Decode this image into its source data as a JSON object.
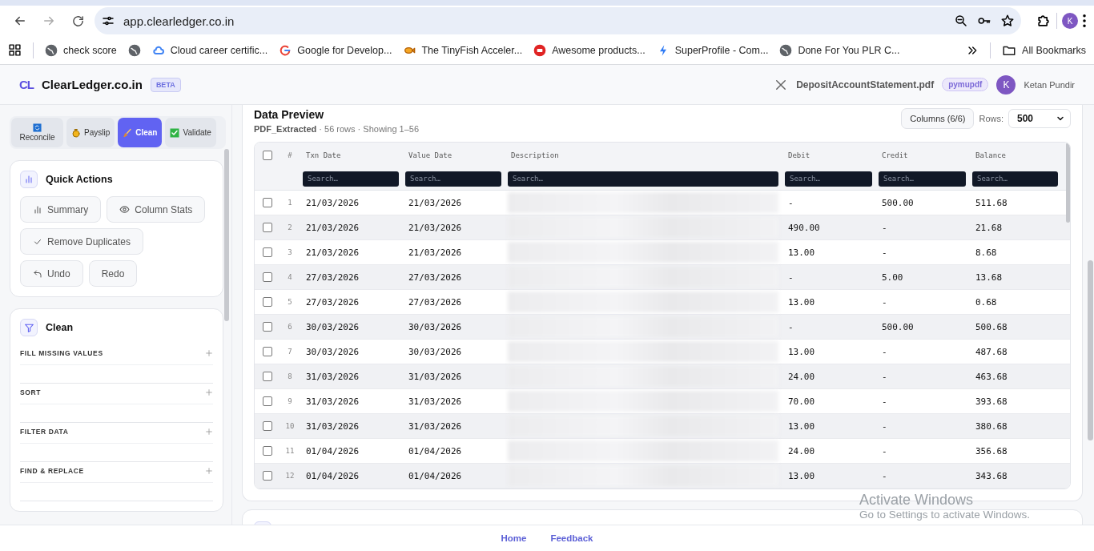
{
  "browser": {
    "url": "app.clearledger.co.in",
    "profile_initial": "K",
    "bookmarks": [
      {
        "label": "check score"
      },
      {
        "label": "Cloud career certific..."
      },
      {
        "label": "Google for Develop..."
      },
      {
        "label": "The TinyFish Acceler..."
      },
      {
        "label": "Awesome products..."
      },
      {
        "label": "SuperProfile - Com..."
      },
      {
        "label": "Done For You PLR C..."
      }
    ],
    "all_bookmarks": "All Bookmarks"
  },
  "app": {
    "logo_mark": "CL",
    "name": "ClearLedger.co.in",
    "badge": "BETA",
    "file_name": "DepositAccountStatement.pdf",
    "engine": "pymupdf",
    "user_initial": "K",
    "user_name": "Ketan Pundir"
  },
  "sidebar": {
    "tabs": [
      {
        "label": "Reconcile",
        "selected": false
      },
      {
        "label": "Payslip",
        "selected": false
      },
      {
        "label": "Clean",
        "selected": true
      },
      {
        "label": "Validate",
        "selected": false
      }
    ],
    "quick_actions": {
      "title": "Quick Actions",
      "buttons": [
        {
          "label": "Summary"
        },
        {
          "label": "Column Stats"
        },
        {
          "label": "Remove Duplicates"
        },
        {
          "label": "Undo"
        },
        {
          "label": "Redo"
        }
      ]
    },
    "clean": {
      "title": "Clean",
      "sections": [
        {
          "label": "FILL MISSING VALUES",
          "expanded": false
        },
        {
          "label": "SORT",
          "expanded": false
        },
        {
          "label": "FILTER DATA",
          "expanded": false
        },
        {
          "label": "FIND & REPLACE",
          "expanded": false
        }
      ]
    }
  },
  "preview": {
    "title": "Data Preview",
    "source": "PDF_Extracted",
    "meta": " · 56 rows · Showing 1–56",
    "columns_button": "Columns (6/6)",
    "rows_label": "Rows:",
    "rows_value": "500",
    "table": {
      "all_checked": false,
      "number_header": "#",
      "columns": [
        {
          "name": "Txn Date",
          "placeholder": "Search…"
        },
        {
          "name": "Value Date",
          "placeholder": "Search…"
        },
        {
          "name": "Description",
          "placeholder": "Search…"
        },
        {
          "name": "Debit",
          "placeholder": "Search…"
        },
        {
          "name": "Credit",
          "placeholder": "Search…"
        },
        {
          "name": "Balance",
          "placeholder": "Search…"
        }
      ],
      "rows": [
        {
          "n": "1",
          "checked": false,
          "cells": [
            "21/03/2026",
            "21/03/2026",
            "",
            "-",
            "500.00",
            "511.68"
          ]
        },
        {
          "n": "2",
          "checked": false,
          "cells": [
            "21/03/2026",
            "21/03/2026",
            "",
            "490.00",
            "-",
            "21.68"
          ]
        },
        {
          "n": "3",
          "checked": false,
          "cells": [
            "21/03/2026",
            "21/03/2026",
            "",
            "13.00",
            "-",
            "8.68"
          ]
        },
        {
          "n": "4",
          "checked": false,
          "cells": [
            "27/03/2026",
            "27/03/2026",
            "",
            "-",
            "5.00",
            "13.68"
          ]
        },
        {
          "n": "5",
          "checked": false,
          "cells": [
            "27/03/2026",
            "27/03/2026",
            "",
            "13.00",
            "-",
            "0.68"
          ]
        },
        {
          "n": "6",
          "checked": false,
          "cells": [
            "30/03/2026",
            "30/03/2026",
            "",
            "-",
            "500.00",
            "500.68"
          ]
        },
        {
          "n": "7",
          "checked": false,
          "cells": [
            "30/03/2026",
            "30/03/2026",
            "",
            "13.00",
            "-",
            "487.68"
          ]
        },
        {
          "n": "8",
          "checked": false,
          "cells": [
            "31/03/2026",
            "31/03/2026",
            "",
            "24.00",
            "-",
            "463.68"
          ]
        },
        {
          "n": "9",
          "checked": false,
          "cells": [
            "31/03/2026",
            "31/03/2026",
            "",
            "70.00",
            "-",
            "393.68"
          ]
        },
        {
          "n": "10",
          "checked": false,
          "cells": [
            "31/03/2026",
            "31/03/2026",
            "",
            "13.00",
            "-",
            "380.68"
          ]
        },
        {
          "n": "11",
          "checked": false,
          "cells": [
            "01/04/2026",
            "01/04/2026",
            "",
            "24.00",
            "-",
            "356.68"
          ]
        },
        {
          "n": "12",
          "checked": false,
          "cells": [
            "01/04/2026",
            "01/04/2026",
            "",
            "13.00",
            "-",
            "343.68"
          ]
        }
      ]
    }
  },
  "footer": {
    "links": [
      "Home",
      "Feedback"
    ]
  },
  "os_notice": {
    "title": "Activate Windows",
    "subtitle": "Go to Settings to activate Windows."
  }
}
